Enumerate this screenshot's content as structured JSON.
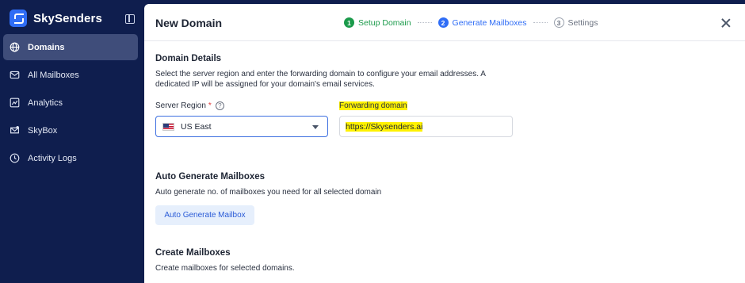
{
  "brand": {
    "name": "SkySenders"
  },
  "sidebar": {
    "items": [
      {
        "label": "Domains",
        "icon": "globe-icon",
        "active": true
      },
      {
        "label": "All Mailboxes",
        "icon": "mail-icon",
        "active": false
      },
      {
        "label": "Analytics",
        "icon": "analytics-icon",
        "active": false
      },
      {
        "label": "SkyBox",
        "icon": "inbox-icon",
        "active": false
      },
      {
        "label": "Activity Logs",
        "icon": "clock-icon",
        "active": false
      }
    ]
  },
  "modal": {
    "title": "New Domain",
    "steps": [
      {
        "num": "1",
        "label": "Setup Domain",
        "state": "done"
      },
      {
        "num": "2",
        "label": "Generate Mailboxes",
        "state": "current"
      },
      {
        "num": "3",
        "label": "Settings",
        "state": "pending"
      }
    ]
  },
  "domain_details": {
    "title": "Domain Details",
    "desc_line1": "Select the server region and enter the forwarding domain to configure your email addresses. A",
    "desc_line2": "dedicated IP will be assigned for your domain's email services.",
    "region_label": "Server Region",
    "region_required": "*",
    "region_help": "?",
    "region_value": "US East",
    "forwarding_label": "Forwarding domain",
    "forwarding_value": "https://Skysenders.ai"
  },
  "auto_generate": {
    "title": "Auto Generate Mailboxes",
    "desc": "Auto generate no. of mailboxes you need for all selected domain",
    "button": "Auto Generate Mailbox"
  },
  "create_mailboxes": {
    "title": "Create Mailboxes",
    "desc": "Create mailboxes for selected domains."
  },
  "colors": {
    "sidebar_bg": "#0f1e4e",
    "accent": "#2f6df6",
    "success": "#1a9a4a",
    "highlight": "#fff200"
  }
}
